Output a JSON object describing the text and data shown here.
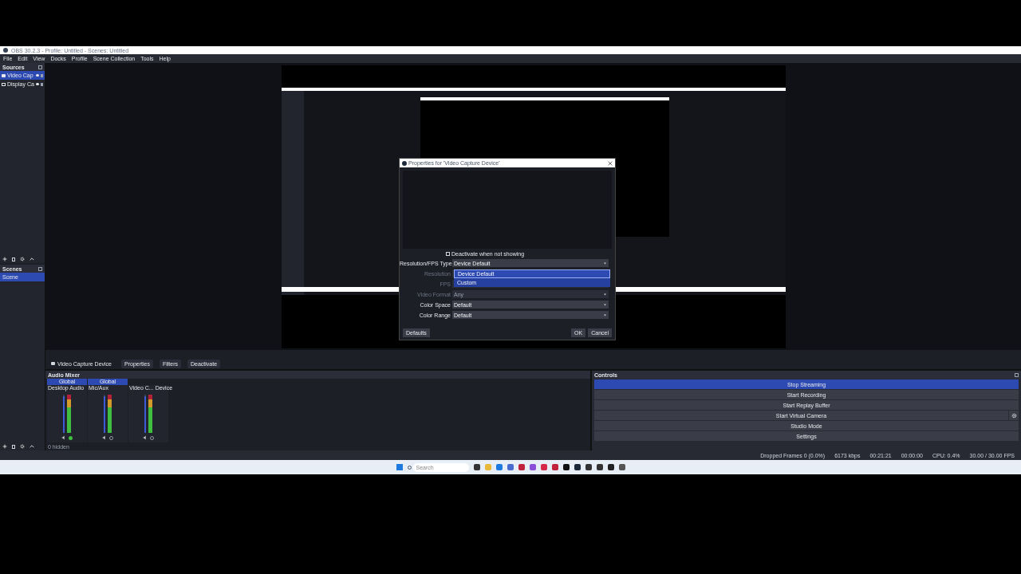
{
  "window": {
    "title": "OBS 30.2.3 - Profile: Untitled - Scenes: Untitled"
  },
  "menu": [
    "File",
    "Edit",
    "View",
    "Docks",
    "Profile",
    "Scene Collection",
    "Tools",
    "Help"
  ],
  "sources": {
    "title": "Sources",
    "items": [
      {
        "name": "Video Cap",
        "kind": "camera",
        "selected": true
      },
      {
        "name": "Display Ca",
        "kind": "display",
        "selected": false
      }
    ]
  },
  "scenes": {
    "title": "Scenes",
    "items": [
      {
        "name": "Scene",
        "selected": true
      }
    ]
  },
  "dialog": {
    "title": "Properties for 'Video Capture Device'",
    "checkbox": {
      "label": "Deactivate when not showing",
      "checked": false
    },
    "fields": [
      {
        "label": "Resolution/FPS Type",
        "value": "Device Default",
        "disabled": false
      },
      {
        "label": "Resolution",
        "disabled": true
      },
      {
        "label": "FPS",
        "disabled": true
      },
      {
        "label": "Video Format",
        "value": "Any",
        "disabled": true
      },
      {
        "label": "Color Space",
        "value": "Default",
        "disabled": false
      },
      {
        "label": "Color Range",
        "value": "Default",
        "disabled": false
      }
    ],
    "dropdown": [
      {
        "label": "Device Default",
        "selected": true
      },
      {
        "label": "Custom",
        "selected": false
      }
    ],
    "buttons": [
      "Defaults",
      "OK",
      "Cancel"
    ]
  },
  "context_bar": {
    "source": "Video Capture Device",
    "buttons": [
      "Properties",
      "Filters",
      "Deactivate"
    ]
  },
  "audio_mixer": {
    "title": "Audio Mixer",
    "channels": [
      {
        "name": "Desktop Audio",
        "level": 0.95,
        "monitor": true
      },
      {
        "name": "Mic/Aux",
        "level": 0.95,
        "monitor": false
      },
      {
        "name": "Video C...",
        "extra": "Device",
        "level": 0.95,
        "monitor": false
      }
    ],
    "tabs": [
      "Global",
      "Global"
    ]
  },
  "controls": {
    "title": "Controls",
    "buttons": [
      {
        "label": "Stop Streaming",
        "active": true
      },
      {
        "label": "Start Recording",
        "active": false
      },
      {
        "label": "Start Replay Buffer",
        "active": false
      },
      {
        "label": "Start Virtual Camera",
        "active": false,
        "gear": true
      },
      {
        "label": "Studio Mode",
        "active": false
      },
      {
        "label": "Settings",
        "active": false
      }
    ]
  },
  "mixer_footer": "0 hidden",
  "status_bar": [
    "Dropped Frames 0 (0.0%)",
    "6173 kbps",
    "00:21:21",
    "00:00:00",
    "CPU: 0.4%",
    "30.00 / 30.00 FPS"
  ],
  "taskbar": {
    "search": {
      "placeholder": "Search"
    }
  }
}
